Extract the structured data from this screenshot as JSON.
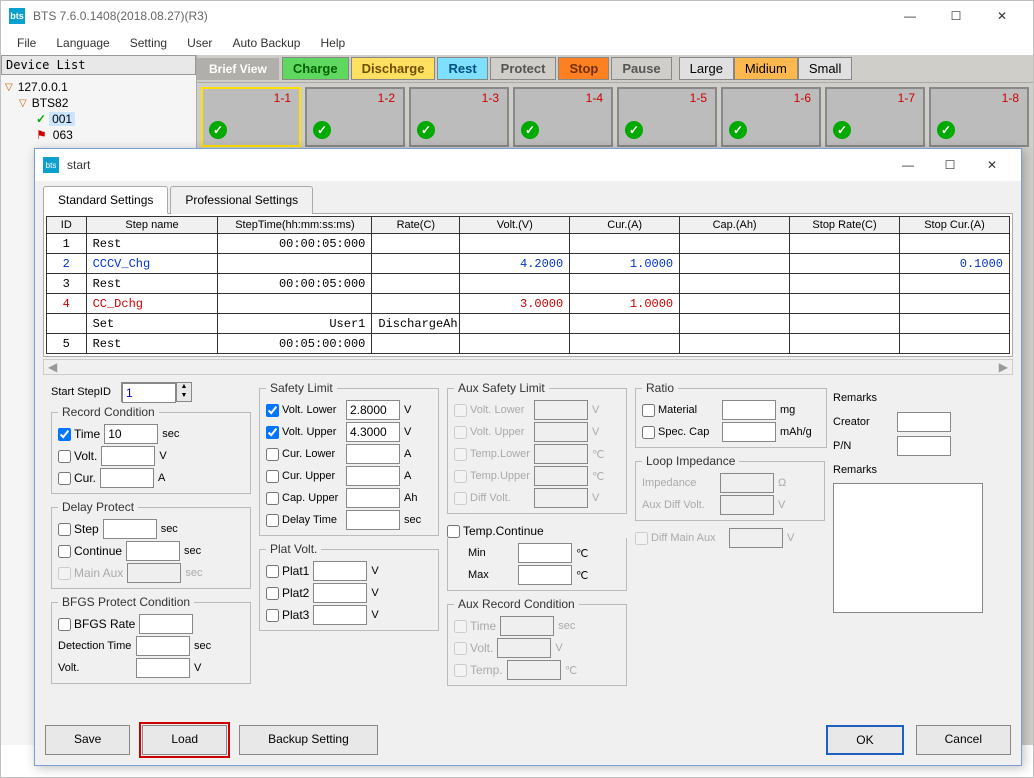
{
  "app_title": "BTS 7.6.0.1408(2018.08.27)(R3)",
  "menu": [
    "File",
    "Language",
    "Setting",
    "User",
    "Auto Backup",
    "Help"
  ],
  "sidebar": {
    "header": "Device List",
    "root": "127.0.0.1",
    "dev": "BTS82",
    "ch1": "001",
    "ch2": "063"
  },
  "brief": {
    "label": "Brief View",
    "modes": [
      "Charge",
      "Discharge",
      "Rest",
      "Protect",
      "Stop",
      "Pause"
    ],
    "sizes": [
      "Large",
      "Midium",
      "Small"
    ]
  },
  "channels": [
    "1-1",
    "1-2",
    "1-3",
    "1-4",
    "1-5",
    "1-6",
    "1-7",
    "1-8"
  ],
  "dialog": {
    "title": "start",
    "tabs": [
      "Standard Settings",
      "Professional Settings"
    ]
  },
  "grid_headers": [
    "ID",
    "Step name",
    "StepTime(hh:mm:ss:ms)",
    "Rate(C)",
    "Volt.(V)",
    "Cur.(A)",
    "Cap.(Ah)",
    "Stop Rate(C)",
    "Stop Cur.(A)"
  ],
  "steps": [
    {
      "id": "1",
      "name": "Rest",
      "time": "00:00:05:000",
      "rate": "",
      "volt": "",
      "cur": "",
      "cap": "",
      "srate": "",
      "scur": "",
      "cls": ""
    },
    {
      "id": "2",
      "name": "CCCV_Chg",
      "time": "",
      "rate": "",
      "volt": "4.2000",
      "cur": "1.0000",
      "cap": "",
      "srate": "",
      "scur": "0.1000",
      "cls": "blue"
    },
    {
      "id": "3",
      "name": "Rest",
      "time": "00:00:05:000",
      "rate": "",
      "volt": "",
      "cur": "",
      "cap": "",
      "srate": "",
      "scur": "",
      "cls": ""
    },
    {
      "id": "4",
      "name": "CC_Dchg",
      "time": "",
      "rate": "",
      "volt": "3.0000",
      "cur": "1.0000",
      "cap": "",
      "srate": "",
      "scur": "",
      "cls": "red"
    },
    {
      "id": "",
      "name": "Set",
      "time": "User1",
      "rate": "DischargeAh",
      "volt": "",
      "cur": "",
      "cap": "",
      "srate": "",
      "scur": "",
      "cls": ""
    },
    {
      "id": "5",
      "name": "Rest",
      "time": "00:05:00:000",
      "rate": "",
      "volt": "",
      "cur": "",
      "cap": "",
      "srate": "",
      "scur": "",
      "cls": ""
    }
  ],
  "start_step": {
    "label": "Start StepID",
    "value": "1"
  },
  "record": {
    "legend": "Record Condition",
    "time_lbl": "Time",
    "time_val": "10",
    "time_unit": "sec",
    "volt_lbl": "Volt.",
    "volt_unit": "V",
    "cur_lbl": "Cur.",
    "cur_unit": "A"
  },
  "delay": {
    "legend": "Delay Protect",
    "step_lbl": "Step",
    "step_unit": "sec",
    "cont_lbl": "Continue",
    "cont_unit": "sec",
    "main_lbl": "Main Aux",
    "main_unit": "sec"
  },
  "bfgs": {
    "legend": "BFGS Protect Condition",
    "rate_lbl": "BFGS Rate",
    "det_lbl": "Detection Time",
    "det_unit": "sec",
    "volt_lbl": "Volt.",
    "volt_unit": "V"
  },
  "safety": {
    "legend": "Safety Limit",
    "vl_lbl": "Volt. Lower",
    "vl_val": "2.8000",
    "vu_lbl": "Volt. Upper",
    "vu_val": "4.3000",
    "cl_lbl": "Cur. Lower",
    "cu_lbl": "Cur. Upper",
    "cap_lbl": "Cap. Upper",
    "dt_lbl": "Delay Time",
    "unit_v": "V",
    "unit_a": "A",
    "unit_ah": "Ah",
    "unit_s": "sec"
  },
  "plat": {
    "legend": "Plat Volt.",
    "p1": "Plat1",
    "p2": "Plat2",
    "p3": "Plat3",
    "unit": "V"
  },
  "aux": {
    "legend": "Aux Safety Limit",
    "vl": "Volt. Lower",
    "vu": "Volt. Upper",
    "tl": "Temp.Lower",
    "tu": "Temp.Upper",
    "dv": "Diff Volt.",
    "unit_v": "V",
    "unit_c": "℃"
  },
  "tcont": {
    "lbl": "Temp.Continue",
    "min": "Min",
    "max": "Max",
    "unit": "℃"
  },
  "auxrec": {
    "legend": "Aux Record Condition",
    "t": "Time",
    "t_unit": "sec",
    "v": "Volt.",
    "v_unit": "V",
    "tm": "Temp.",
    "tm_unit": "℃"
  },
  "ratio": {
    "legend": "Ratio",
    "mat": "Material",
    "mat_u": "mg",
    "spec": "Spec. Cap",
    "spec_u": "mAh/g"
  },
  "loop": {
    "legend": "Loop Impedance",
    "imp": "Impedance",
    "imp_u": "Ω",
    "adv": "Aux Diff Volt.",
    "adv_u": "V",
    "dma": "Diff Main Aux",
    "dma_u": "V"
  },
  "remarks": {
    "hdr": "Remarks",
    "creator": "Creator",
    "pn": "P/N",
    "rem": "Remarks"
  },
  "buttons": {
    "save": "Save",
    "load": "Load",
    "backup": "Backup Setting",
    "ok": "OK",
    "cancel": "Cancel"
  }
}
